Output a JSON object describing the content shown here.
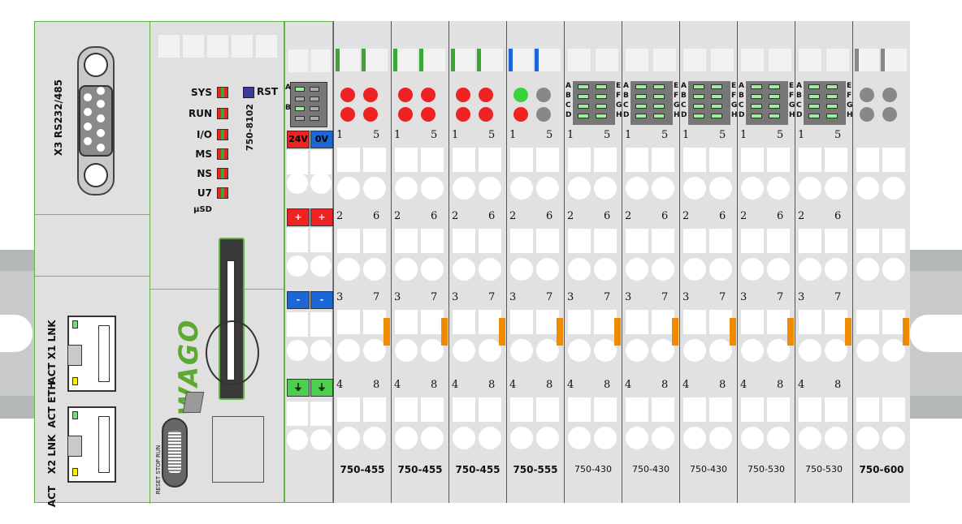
{
  "coupler": {
    "serial_port_label": "X3 RS232/485",
    "status_leds": [
      {
        "label": "SYS"
      },
      {
        "label": "RUN"
      },
      {
        "label": "I/O"
      },
      {
        "label": "MS"
      },
      {
        "label": "NS"
      },
      {
        "label": "U7"
      },
      {
        "label": "µSD"
      }
    ],
    "rst_label": "RST",
    "model": "750-8102",
    "switch_label": "RESET STOP RUN",
    "eth_label_x1": "ACT X1 LNK",
    "eth_label_mid": "ACT ETH",
    "eth_label_x2": "X2 LNK",
    "eth_label_act": "ACT"
  },
  "power_supply": {
    "buttons": [
      {
        "left": "24V",
        "right": "0V"
      },
      {
        "left": "+",
        "right": "+"
      },
      {
        "left": "-",
        "right": "-"
      },
      {
        "left": "⏚",
        "right": "⏚"
      }
    ]
  },
  "modules": [
    {
      "label": "750-455"
    },
    {
      "label": "750-455"
    },
    {
      "label": "750-455"
    },
    {
      "label": "750-555"
    },
    {
      "label": "750-430"
    },
    {
      "label": "750-430"
    },
    {
      "label": "750-430"
    },
    {
      "label": "750-530"
    },
    {
      "label": "750-530"
    },
    {
      "label": "750-600"
    }
  ],
  "terminal_numbers": [
    [
      "1",
      "5"
    ],
    [
      "2",
      "6"
    ],
    [
      "3",
      "7"
    ],
    [
      "4",
      "8"
    ]
  ],
  "di_letters": {
    "left": [
      "A",
      "B",
      "C",
      "D"
    ],
    "right": [
      "E",
      "F",
      "G",
      "H"
    ]
  },
  "power_led_letters": [
    "A",
    "B"
  ],
  "brand": "WAGO",
  "colors": {
    "green_led": "#39a636",
    "red_led": "#ee2222",
    "blue_led": "#1c66d8",
    "orange_marker": "#f08a00",
    "rail": "#c9cbcb"
  }
}
